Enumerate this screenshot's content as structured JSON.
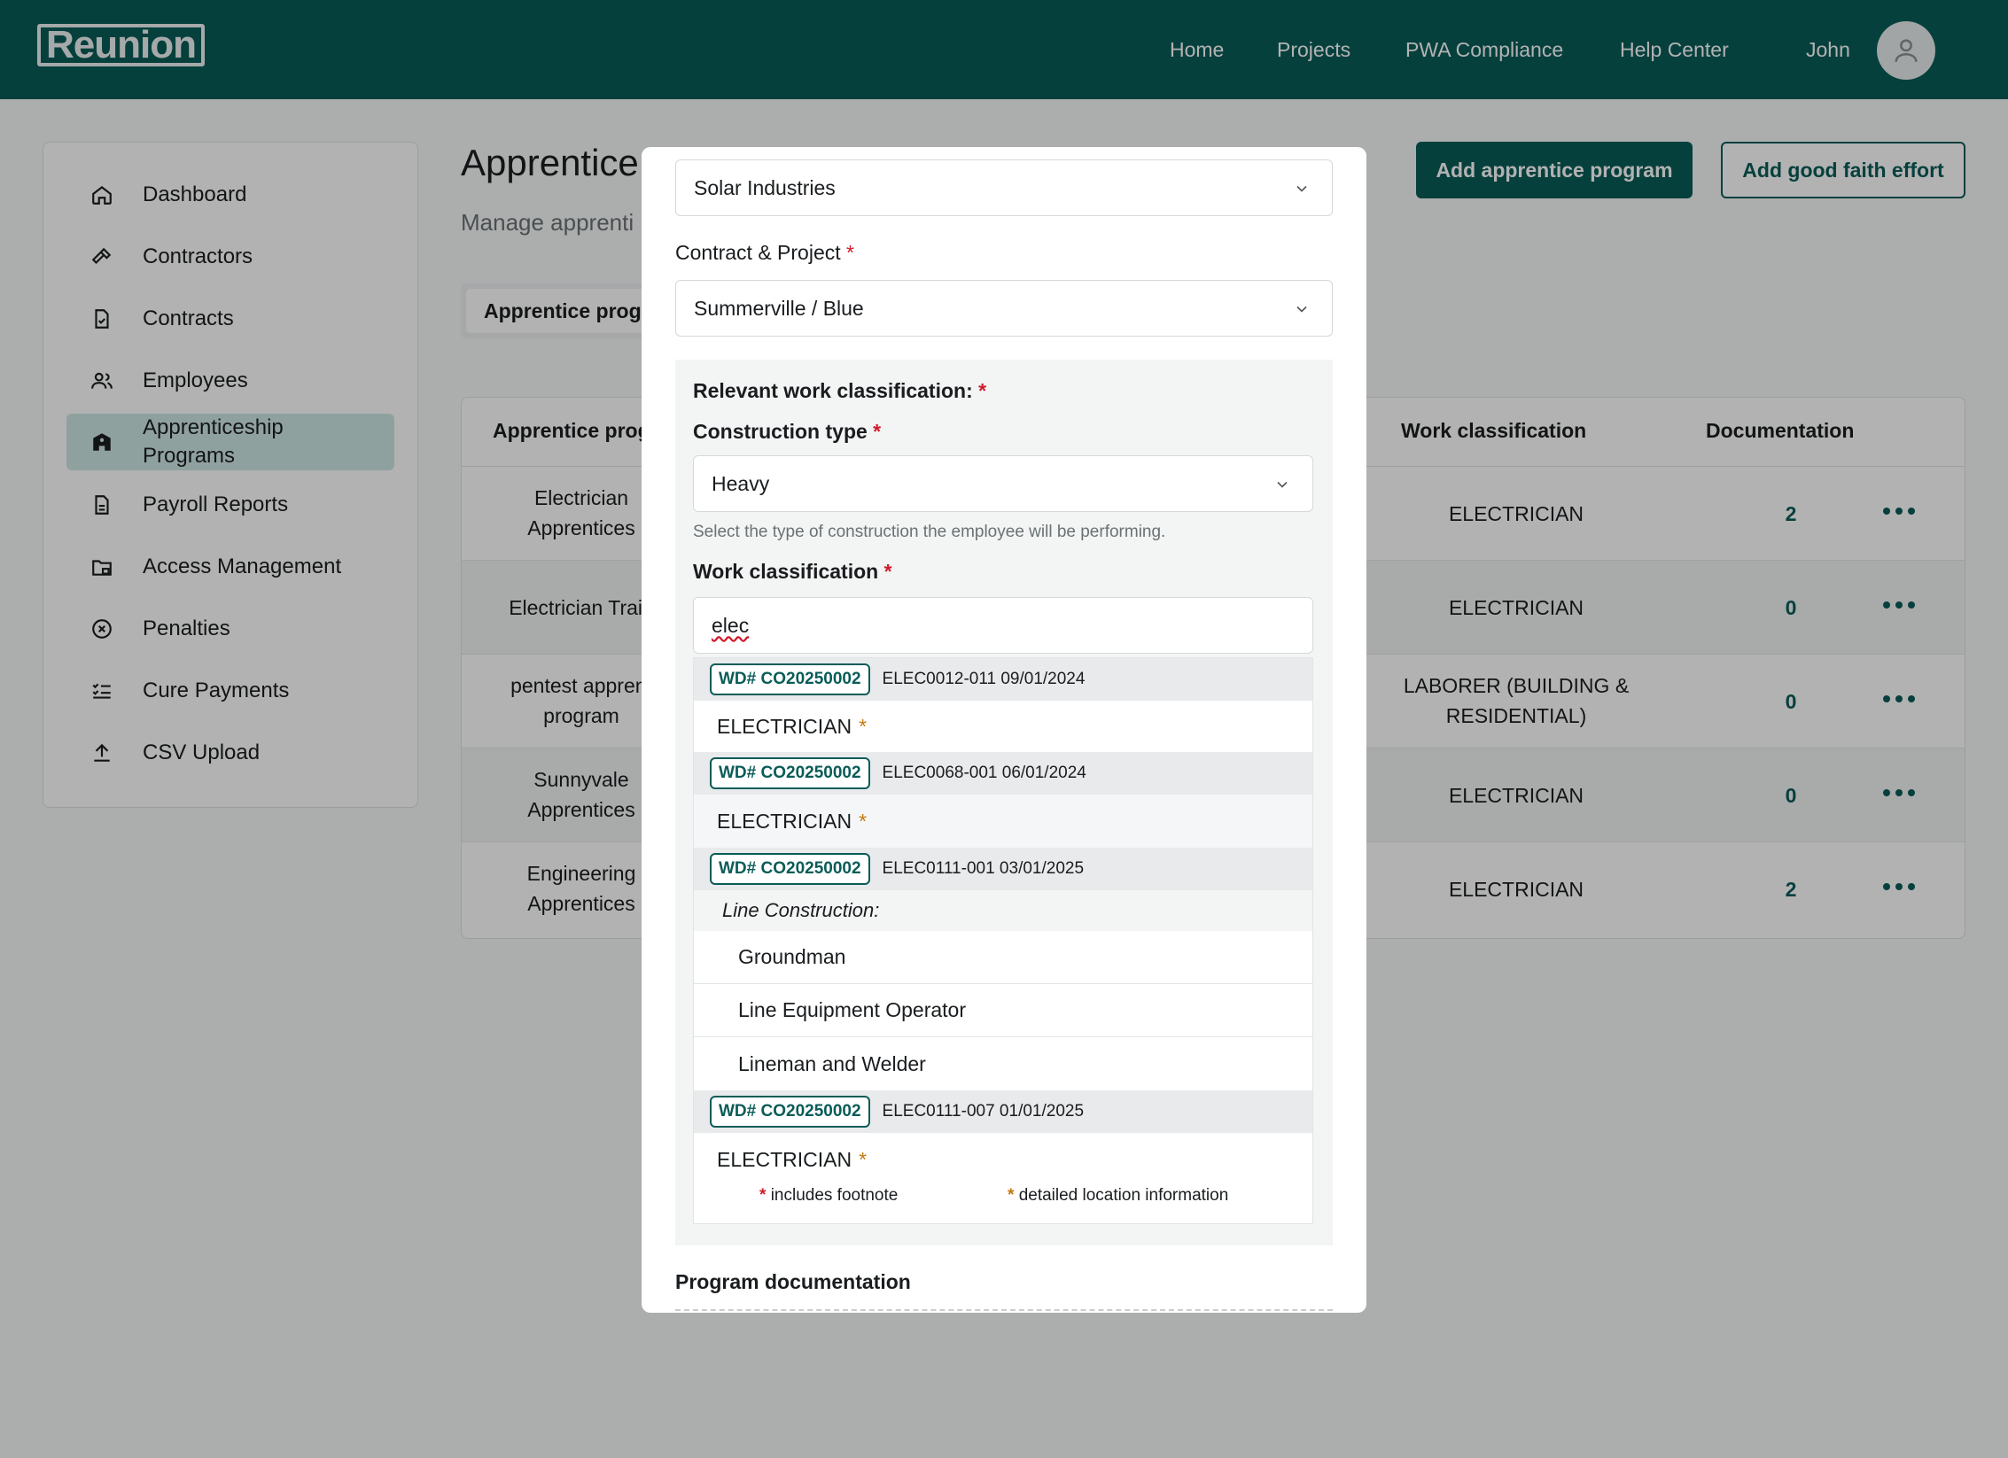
{
  "header": {
    "logo": "Reunion",
    "nav": [
      "Home",
      "Projects",
      "PWA Compliance",
      "Help Center"
    ],
    "user": "John"
  },
  "sidebar": {
    "items": [
      {
        "label": "Dashboard",
        "icon": "home-icon"
      },
      {
        "label": "Contractors",
        "icon": "hammer-icon"
      },
      {
        "label": "Contracts",
        "icon": "document-icon"
      },
      {
        "label": "Employees",
        "icon": "users-icon"
      },
      {
        "label": "Apprenticeship Programs",
        "icon": "school-icon"
      },
      {
        "label": "Payroll Reports",
        "icon": "report-icon"
      },
      {
        "label": "Access Management",
        "icon": "folder-lock-icon"
      },
      {
        "label": "Penalties",
        "icon": "x-circle-icon"
      },
      {
        "label": "Cure Payments",
        "icon": "checklist-icon"
      },
      {
        "label": "CSV Upload",
        "icon": "upload-icon"
      }
    ]
  },
  "main": {
    "title": "Apprentice",
    "subtitle": "Manage apprenti",
    "add_program_button": "Add apprentice program",
    "add_gfe_button": "Add good faith effort",
    "tab": "Apprentice progr"
  },
  "table": {
    "headers": {
      "program": "Apprentice prog",
      "work_classification": "Work classification",
      "documentation": "Documentation"
    },
    "rows": [
      {
        "program": "Electrician\nApprentices",
        "classification": "ELECTRICIAN",
        "docs": "2"
      },
      {
        "program": "Electrician Train",
        "classification": "ELECTRICIAN",
        "docs": "0"
      },
      {
        "program": "pentest apprent\nprogram",
        "classification": "LABORER (BUILDING &\nRESIDENTIAL)",
        "docs": "0"
      },
      {
        "program": "Sunnyvale\nApprentices",
        "classification": "ELECTRICIAN",
        "docs": "0"
      },
      {
        "program": "Engineering\nApprentices",
        "classification": "ELECTRICIAN",
        "docs": "2"
      }
    ]
  },
  "modal": {
    "company_select": "Solar Industries",
    "contract_label": "Contract & Project",
    "contract_select": "Summerville / Blue",
    "relevant_label": "Relevant work classification:",
    "construction_label": "Construction type",
    "construction_select": "Heavy",
    "construction_help": "Select the type of construction the employee will be performing.",
    "work_class_label": "Work classification",
    "search_value": "elec",
    "groups": [
      {
        "badge": "WD# CO20250002",
        "meta": "ELEC0012-011 09/01/2024",
        "option": "ELECTRICIAN"
      },
      {
        "badge": "WD# CO20250002",
        "meta": "ELEC0068-001 06/01/2024",
        "option": "ELECTRICIAN"
      },
      {
        "badge": "WD# CO20250002",
        "meta": "ELEC0111-001 03/01/2025",
        "subheading": "Line Construction:",
        "suboptions": [
          "Groundman",
          "Line Equipment Operator",
          "Lineman and Welder"
        ]
      },
      {
        "badge": "WD# CO20250002",
        "meta": "ELEC0111-007 01/01/2025",
        "option": "ELECTRICIAN"
      }
    ],
    "legend": {
      "footnote": "includes footnote",
      "location": "detailed location information"
    },
    "program_doc_label": "Program documentation",
    "required_mark": "*"
  },
  "colors": {
    "brand": "#0a5c58",
    "required": "#d11a2a",
    "star": "#c47a10"
  }
}
